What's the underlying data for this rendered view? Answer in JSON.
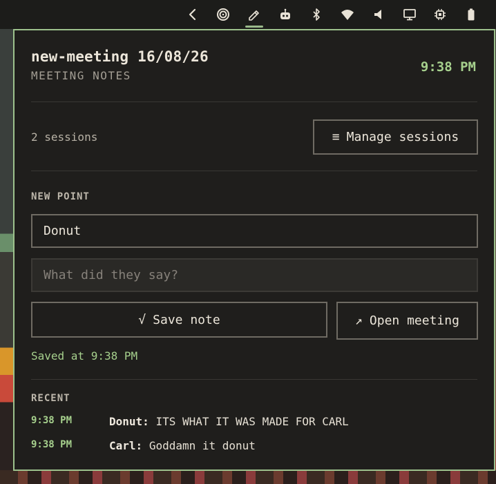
{
  "topbar": {
    "icons": [
      "chevron-left-icon",
      "spiral-icon",
      "pencil-icon",
      "robot-icon",
      "bluetooth-icon",
      "wifi-icon",
      "volume-icon",
      "monitor-icon",
      "cpu-icon",
      "battery-icon"
    ],
    "active_icon": "pencil-icon",
    "accent": "#9dc28d"
  },
  "panel": {
    "title": "new-meeting 16/08/26",
    "subtitle": "MEETING NOTES",
    "clock": "9:38 PM",
    "sessions_count": "2 sessions",
    "manage_button": "Manage sessions",
    "new_point_label": "NEW POINT",
    "speaker_value": "Donut",
    "note_placeholder": "What did they say?",
    "save_button": "Save note",
    "open_button": "Open meeting",
    "saved_status": "Saved at 9:38 PM",
    "recent_label": "RECENT",
    "recent": [
      {
        "time": "9:38 PM",
        "speaker": "Donut:",
        "text": "ITS WHAT IT WAS MADE FOR CARL"
      },
      {
        "time": "9:38 PM",
        "speaker": "Carl:",
        "text": "Goddamn it donut"
      }
    ]
  },
  "colors": {
    "accent_green": "#a6d08d",
    "panel_bg": "#1f1e1c",
    "border": "#6f6b63"
  }
}
